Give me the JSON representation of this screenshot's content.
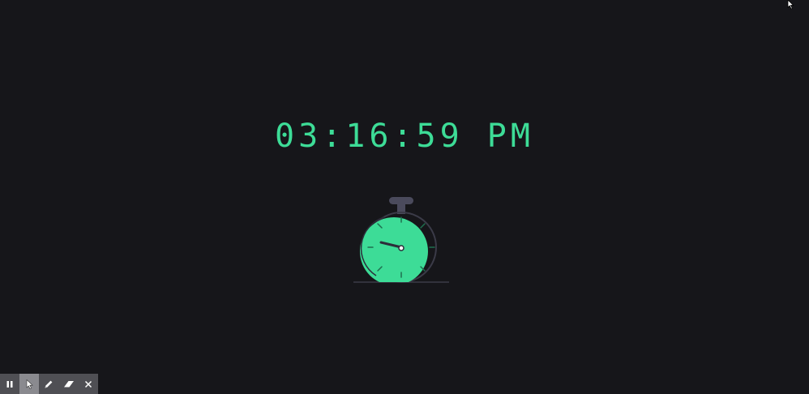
{
  "clock": {
    "time_text": "03:16:59 PM"
  },
  "colors": {
    "background": "#16161a",
    "accent": "#3ddc97",
    "face": "#3ddc97",
    "dark_outline": "#3b3b48",
    "crown": "#4a4a5c",
    "hand": "#2d2d3a",
    "toolbar_bg": "#4f4f54",
    "toolbar_active": "#8a8a8f",
    "toolbar_icon": "#ffffff"
  },
  "icons": {
    "cursor": "mouse-pointer-icon",
    "stopwatch": "stopwatch-illustration"
  },
  "toolbar": {
    "tools": [
      {
        "name": "pause-icon",
        "active": false
      },
      {
        "name": "pointer-icon",
        "active": true
      },
      {
        "name": "pencil-icon",
        "active": false
      },
      {
        "name": "eraser-icon",
        "active": false
      },
      {
        "name": "close-icon",
        "active": false
      }
    ]
  }
}
